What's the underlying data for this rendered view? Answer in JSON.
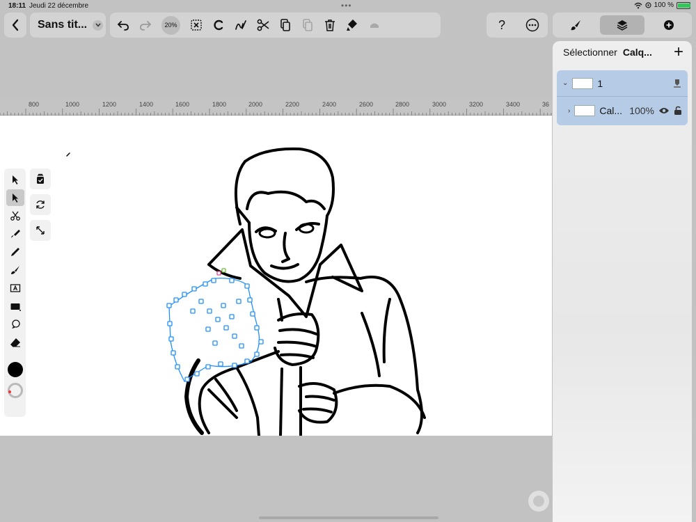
{
  "status": {
    "time": "18:11",
    "date": "Jeudi 22 décembre",
    "battery": "100 %",
    "icons": [
      "wifi-icon",
      "location-icon",
      "battery-icon"
    ]
  },
  "document": {
    "title": "Sans tit..."
  },
  "toolbar": {
    "zoom": "20%",
    "icons": [
      "undo-icon",
      "redo-icon",
      "zoom-indicator",
      "deselect-icon",
      "rotate-icon",
      "scribble-icon",
      "cut-icon",
      "copy-icon",
      "paste-icon",
      "delete-icon",
      "fill-icon",
      "eraser-fill-icon"
    ]
  },
  "help": {
    "label": "?"
  },
  "panel_tabs": [
    "brush-tab",
    "layers-tab",
    "add-tab"
  ],
  "rulers": [
    "800",
    "1000",
    "1200",
    "1400",
    "1600",
    "1800",
    "2000",
    "2200",
    "2400",
    "2600",
    "2800",
    "3000",
    "3200",
    "3400",
    "36"
  ],
  "layers": {
    "select_label": "Sélectionner",
    "panel_name": "Calq...",
    "add_label": "+",
    "group": {
      "name": "1"
    },
    "layer": {
      "name": "Cal...",
      "opacity": "100%"
    }
  },
  "colors": {
    "accent": "#b6cce6",
    "selection": "#1e90ff",
    "background": "#c2c2c2"
  }
}
